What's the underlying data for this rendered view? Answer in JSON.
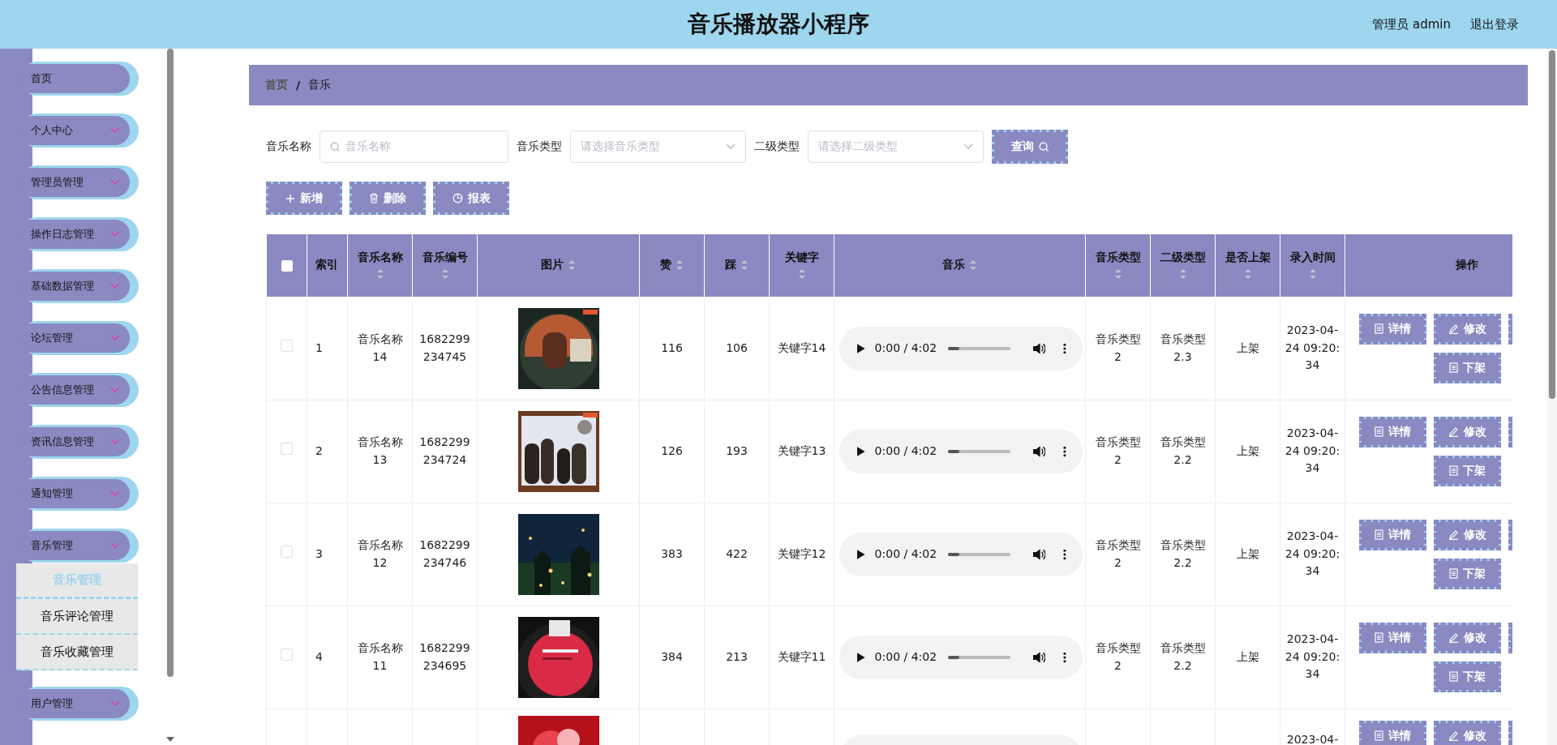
{
  "header": {
    "title": "音乐播放器小程序",
    "user": "管理员 admin",
    "logout": "退出登录"
  },
  "sidebar": {
    "items": [
      {
        "label": "首页",
        "expandable": false
      },
      {
        "label": "个人中心",
        "expandable": true
      },
      {
        "label": "管理员管理",
        "expandable": true
      },
      {
        "label": "操作日志管理",
        "expandable": true
      },
      {
        "label": "基础数据管理",
        "expandable": true
      },
      {
        "label": "论坛管理",
        "expandable": true
      },
      {
        "label": "公告信息管理",
        "expandable": true
      },
      {
        "label": "资讯信息管理",
        "expandable": true
      },
      {
        "label": "通知管理",
        "expandable": true
      },
      {
        "label": "音乐管理",
        "expandable": true,
        "children": [
          {
            "label": "音乐管理",
            "selected": true
          },
          {
            "label": "音乐评论管理",
            "selected": false
          },
          {
            "label": "音乐收藏管理",
            "selected": false
          }
        ]
      },
      {
        "label": "用户管理",
        "expandable": true
      }
    ]
  },
  "breadcrumb": {
    "separator": "/",
    "items": [
      {
        "label": "首页",
        "current": false
      },
      {
        "label": "音乐",
        "current": true
      }
    ]
  },
  "search": {
    "fields": [
      {
        "label": "音乐名称",
        "kind": "text",
        "placeholder": "音乐名称"
      },
      {
        "label": "音乐类型",
        "kind": "select",
        "placeholder": "请选择音乐类型"
      },
      {
        "label": "二级类型",
        "kind": "select",
        "placeholder": "请选择二级类型"
      }
    ],
    "button": "查询"
  },
  "toolbar": [
    {
      "label": "新增",
      "kind": "plus"
    },
    {
      "label": "删除",
      "kind": "trash"
    },
    {
      "label": "报表",
      "kind": "chart"
    }
  ],
  "table": {
    "header_checked": false,
    "columns": [
      {
        "label": "索引",
        "sortable": false
      },
      {
        "label": "音乐名称",
        "sortable": true
      },
      {
        "label": "音乐编号",
        "sortable": true
      },
      {
        "label": "图片",
        "sortable": true
      },
      {
        "label": "赞",
        "sortable": true
      },
      {
        "label": "踩",
        "sortable": true
      },
      {
        "label": "关键字",
        "sortable": true
      },
      {
        "label": "音乐",
        "sortable": true
      },
      {
        "label": "音乐类型",
        "sortable": true
      },
      {
        "label": "二级类型",
        "sortable": true
      },
      {
        "label": "是否上架",
        "sortable": true
      },
      {
        "label": "录入时间",
        "sortable": true
      },
      {
        "label": "操作",
        "sortable": false
      }
    ],
    "rows": [
      {
        "kind": "full",
        "checked": false,
        "index": "1",
        "name": "音乐名称14",
        "code": "1682299234745",
        "picture": {
          "kind": "picture"
        },
        "likes": "116",
        "dislikes": "106",
        "keyword": "关键字14",
        "audio": {
          "time": "0:00 / 4:02",
          "level": 0.18
        },
        "music_type": "音乐类型2",
        "sub_type": "音乐类型2.3",
        "status": "上架",
        "created": "2023-04-24 09:20:34",
        "actions": [
          {
            "kind": "doc",
            "label": "详情"
          },
          {
            "kind": "pen",
            "label": "修改"
          },
          {
            "kind": "hidden"
          },
          {
            "kind": "doc",
            "label": "下架"
          }
        ]
      },
      {
        "kind": "full",
        "checked": false,
        "index": "2",
        "name": "音乐名称13",
        "code": "1682299234724",
        "picture": {
          "kind": "picture"
        },
        "likes": "126",
        "dislikes": "193",
        "keyword": "关键字13",
        "audio": {
          "time": "0:00 / 4:02",
          "level": 0.18
        },
        "music_type": "音乐类型2",
        "sub_type": "音乐类型2.2",
        "status": "上架",
        "created": "2023-04-24 09:20:34",
        "actions": [
          {
            "kind": "doc",
            "label": "详情"
          },
          {
            "kind": "pen",
            "label": "修改"
          },
          {
            "kind": "hidden"
          },
          {
            "kind": "doc",
            "label": "下架"
          }
        ]
      },
      {
        "kind": "full",
        "checked": false,
        "index": "3",
        "name": "音乐名称12",
        "code": "1682299234746",
        "picture": {
          "kind": "picture"
        },
        "likes": "383",
        "dislikes": "422",
        "keyword": "关键字12",
        "audio": {
          "time": "0:00 / 4:02",
          "level": 0.18
        },
        "music_type": "音乐类型2",
        "sub_type": "音乐类型2.2",
        "status": "上架",
        "created": "2023-04-24 09:20:34",
        "actions": [
          {
            "kind": "doc",
            "label": "详情"
          },
          {
            "kind": "pen",
            "label": "修改"
          },
          {
            "kind": "hidden"
          },
          {
            "kind": "doc",
            "label": "下架"
          }
        ]
      },
      {
        "kind": "full",
        "checked": false,
        "index": "4",
        "name": "音乐名称11",
        "code": "1682299234695",
        "picture": {
          "kind": "picture"
        },
        "likes": "384",
        "dislikes": "213",
        "keyword": "关键字11",
        "audio": {
          "time": "0:00 / 4:02",
          "level": 0.18
        },
        "music_type": "音乐类型2",
        "sub_type": "音乐类型2.2",
        "status": "上架",
        "created": "2023-04-24 09:20:34",
        "actions": [
          {
            "kind": "doc",
            "label": "详情"
          },
          {
            "kind": "pen",
            "label": "修改"
          },
          {
            "kind": "hidden"
          },
          {
            "kind": "doc",
            "label": "下架"
          }
        ]
      },
      {
        "kind": "cut",
        "picture": {
          "kind": "picture"
        },
        "audio": {},
        "created": "2023-04-",
        "actions": [
          {
            "kind": "doc",
            "label": "详情"
          },
          {
            "kind": "pen",
            "label": "修改"
          },
          {
            "kind": "hidden"
          }
        ]
      }
    ]
  }
}
